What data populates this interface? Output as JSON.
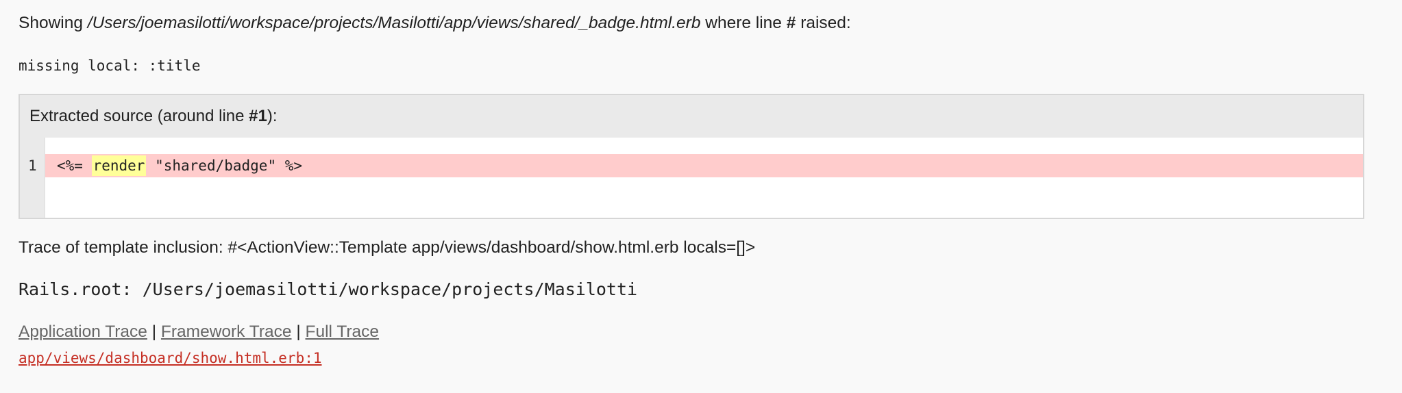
{
  "heading": {
    "prefix": "Showing ",
    "path": "/Users/joemasilotti/workspace/projects/Masilotti/app/views/shared/_badge.html.erb",
    "middle": " where line ",
    "hash": "#",
    "suffix": " raised:"
  },
  "message": "missing local: :title",
  "source": {
    "title_prefix": "Extracted source (around line ",
    "title_line": "#1",
    "title_suffix": "):",
    "line_number": "1",
    "code_before": "<%= ",
    "code_highlight": "render",
    "code_after": " \"shared/badge\" %>",
    "highlight_color": "#ffcccc",
    "keyword_highlight_color": "#ffff99"
  },
  "trace_inclusion": "Trace of template inclusion: #<ActionView::Template app/views/dashboard/show.html.erb locals=[]>",
  "rails_root": "Rails.root: /Users/joemasilotti/workspace/projects/Masilotti",
  "trace_links": {
    "application": "Application Trace",
    "framework": "Framework Trace",
    "full": "Full Trace",
    "separator": " | "
  },
  "trace_entry": "app/views/dashboard/show.html.erb:1",
  "colors": {
    "trace_entry": "#c52f24",
    "background": "#f9f9f9"
  }
}
